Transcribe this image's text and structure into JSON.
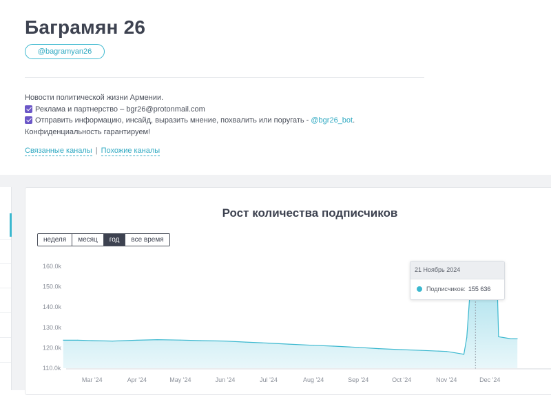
{
  "channel": {
    "title": "Баграмян 26",
    "handle": "@bagramyan26"
  },
  "description": {
    "line1": "Новости политической жизни Армении.",
    "line2": "Реклама и партнерство – bgr26@protonmail.com",
    "line3_text": "Отправить информацию, инсайд, выразить мнение, похвалить или поругать - ",
    "line3_link": "@bgr26_bot",
    "line3_end": ".",
    "line4": "Конфиденциальность гарантируем!"
  },
  "links": {
    "related": "Связанные каналы",
    "separator": "|",
    "similar": "Похожие каналы"
  },
  "chart_card": {
    "title": "Рост количества подписчиков",
    "periods": [
      {
        "label": "неделя",
        "active": false
      },
      {
        "label": "месяц",
        "active": false
      },
      {
        "label": "год",
        "active": true
      },
      {
        "label": "все время",
        "active": false
      }
    ]
  },
  "tooltip": {
    "date": "21 Ноябрь 2024",
    "series_label": "Подписчиков:",
    "value": "155 636"
  },
  "colors": {
    "accent": "#3bb8cf",
    "checkbox": "#6b57c7",
    "area_fill": "#cdeef5",
    "text_dark": "#3d4250"
  },
  "chart_data": {
    "type": "area",
    "title": "Рост количества подписчиков",
    "xlabel": "",
    "ylabel": "",
    "y_ticks": [
      "160.0k",
      "150.0k",
      "140.0k",
      "130.0k",
      "120.0k",
      "110.0k"
    ],
    "y_tick_values": [
      160000,
      150000,
      140000,
      130000,
      120000,
      110000
    ],
    "x_ticks": [
      "Mar '24",
      "Apr '24",
      "May '24",
      "Jun '24",
      "Jul '24",
      "Aug '24",
      "Sep '24",
      "Oct '24",
      "Nov '24",
      "Dec '24"
    ],
    "ylim": [
      110000,
      160000
    ],
    "grid": false,
    "legend": "none",
    "x": [
      "2024-02-10",
      "2024-02-20",
      "2024-03-01",
      "2024-03-15",
      "2024-04-01",
      "2024-04-15",
      "2024-05-01",
      "2024-05-15",
      "2024-06-01",
      "2024-06-15",
      "2024-07-01",
      "2024-07-15",
      "2024-08-01",
      "2024-08-15",
      "2024-09-01",
      "2024-09-15",
      "2024-10-01",
      "2024-10-15",
      "2024-11-01",
      "2024-11-10",
      "2024-11-13",
      "2024-11-15",
      "2024-11-17",
      "2024-11-19",
      "2024-11-21",
      "2024-11-25",
      "2024-12-01",
      "2024-12-06",
      "2024-12-07",
      "2024-12-15",
      "2024-12-20"
    ],
    "y": [
      123700,
      123700,
      123500,
      123300,
      123700,
      124000,
      123800,
      123500,
      123300,
      122800,
      122300,
      121800,
      121200,
      120800,
      120200,
      119600,
      119100,
      118700,
      118200,
      117200,
      116800,
      125000,
      145000,
      150500,
      155636,
      155200,
      153800,
      152700,
      125400,
      124500,
      124400
    ]
  }
}
